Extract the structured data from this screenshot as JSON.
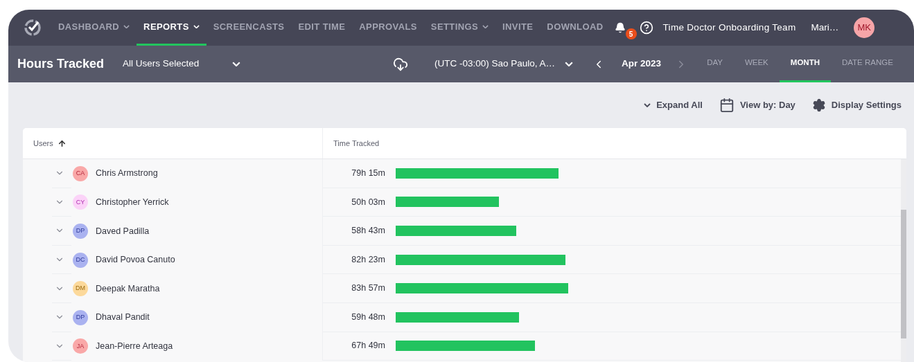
{
  "nav": {
    "items": [
      {
        "label": "DASHBOARD",
        "dropdown": true,
        "selected": false
      },
      {
        "label": "REPORTS",
        "dropdown": true,
        "selected": true
      },
      {
        "label": "SCREENCASTS",
        "dropdown": false,
        "selected": false
      },
      {
        "label": "EDIT TIME",
        "dropdown": false,
        "selected": false
      },
      {
        "label": "APPROVALS",
        "dropdown": false,
        "selected": false
      },
      {
        "label": "SETTINGS",
        "dropdown": true,
        "selected": false
      },
      {
        "label": "INVITE",
        "dropdown": false,
        "selected": false
      },
      {
        "label": "DOWNLOAD",
        "dropdown": false,
        "selected": false
      }
    ],
    "notification_count": "5",
    "team": "Time Doctor Onboarding Team",
    "user": "Mari…",
    "avatar": "MK"
  },
  "subbar": {
    "title": "Hours Tracked",
    "users_select": "All Users Selected",
    "timezone": "(UTC -03:00) Sao Paulo, A…",
    "period": "Apr 2023",
    "ranges": [
      {
        "label": "DAY",
        "selected": false
      },
      {
        "label": "WEEK",
        "selected": false
      },
      {
        "label": "MONTH",
        "selected": true
      },
      {
        "label": "DATE RANGE",
        "selected": false
      }
    ]
  },
  "toolbar": [
    "Expand All",
    "View by: Day",
    "Display Settings"
  ],
  "table": {
    "columns": [
      "Users",
      "Time Tracked"
    ],
    "rows": [
      {
        "initials": "CA",
        "color": "#f9a8a8",
        "name": "Chris Armstrong",
        "time": "79h 15m"
      },
      {
        "initials": "CY",
        "color": "#fbd3f8",
        "name": "Christopher Yerrick",
        "time": "50h 03m"
      },
      {
        "initials": "DP",
        "color": "#aab2f0",
        "name": "Daved Padilla",
        "time": "58h 43m"
      },
      {
        "initials": "DC",
        "color": "#aab2f0",
        "name": "David Povoa Canuto",
        "time": "82h 23m"
      },
      {
        "initials": "DM",
        "color": "#fcd99b",
        "name": "Deepak Maratha",
        "time": "83h 57m"
      },
      {
        "initials": "DP",
        "color": "#aab2f0",
        "name": "Dhaval Pandit",
        "time": "59h 48m"
      },
      {
        "initials": "JA",
        "color": "#f9a8a8",
        "name": "Jean-Pierre Arteaga",
        "time": "67h 49m"
      }
    ]
  }
}
